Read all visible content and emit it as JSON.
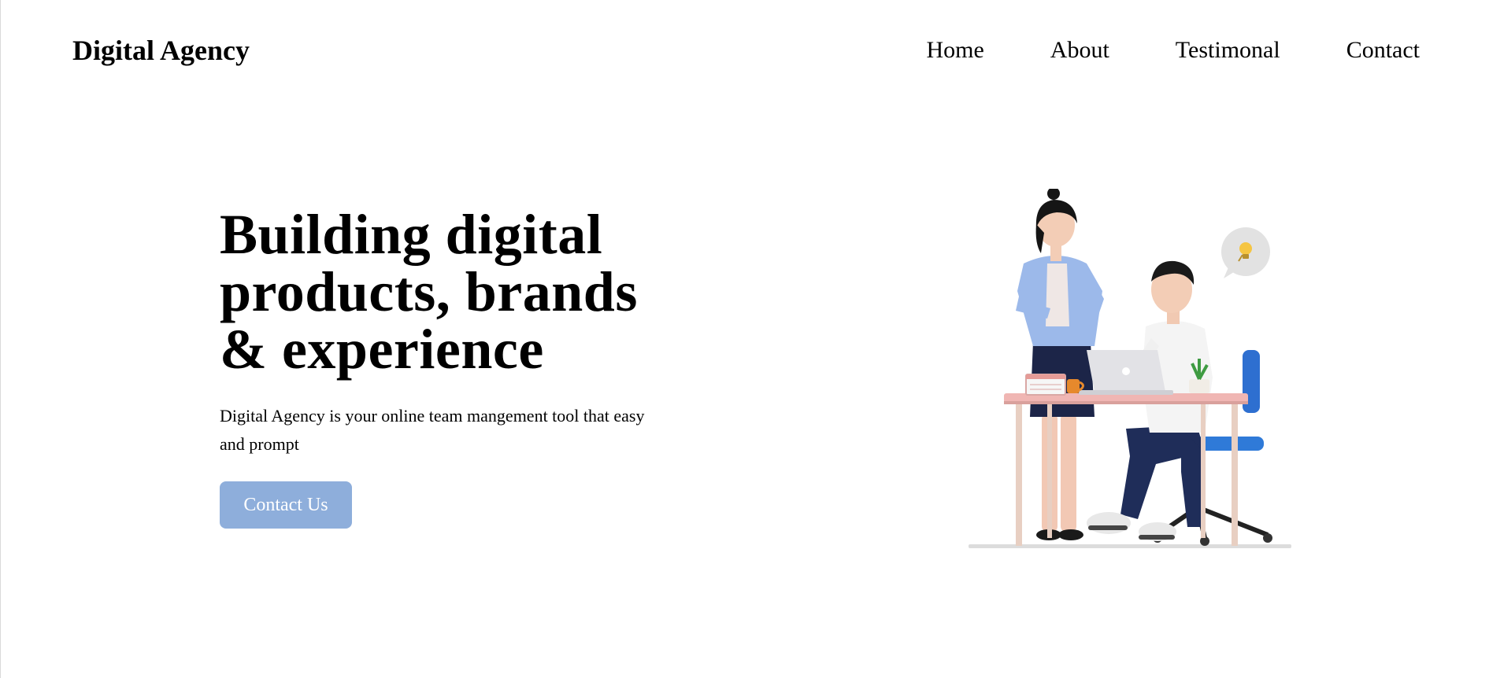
{
  "header": {
    "logo": "Digital Agency",
    "nav": [
      {
        "label": "Home"
      },
      {
        "label": "About"
      },
      {
        "label": "Testimonal"
      },
      {
        "label": "Contact"
      }
    ]
  },
  "hero": {
    "title_lines": [
      "Building digital",
      "products, brands",
      "& experience"
    ],
    "description": "Digital Agency is your online team mangement tool that easy and prompt",
    "cta_label": "Contact Us"
  },
  "colors": {
    "button_bg": "#8eaedb",
    "button_text": "#ffffff",
    "text": "#000000",
    "background": "#ffffff"
  },
  "illustration": {
    "description_icon": "office-team-illustration"
  }
}
